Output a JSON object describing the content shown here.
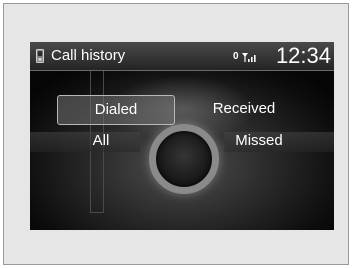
{
  "header": {
    "title": "Call history",
    "signal_digit": "0",
    "signal_label": "",
    "clock": "12:34",
    "phone_icon": "phone-icon"
  },
  "menu": {
    "dialed": "Dialed",
    "received": "Received",
    "all": "All",
    "missed": "Missed",
    "selected": "Dialed"
  },
  "colors": {
    "screen_background": "#000000",
    "text": "#ffffff",
    "frame_background": "#e6e6e6",
    "selection_border": "#b8b8b8"
  }
}
